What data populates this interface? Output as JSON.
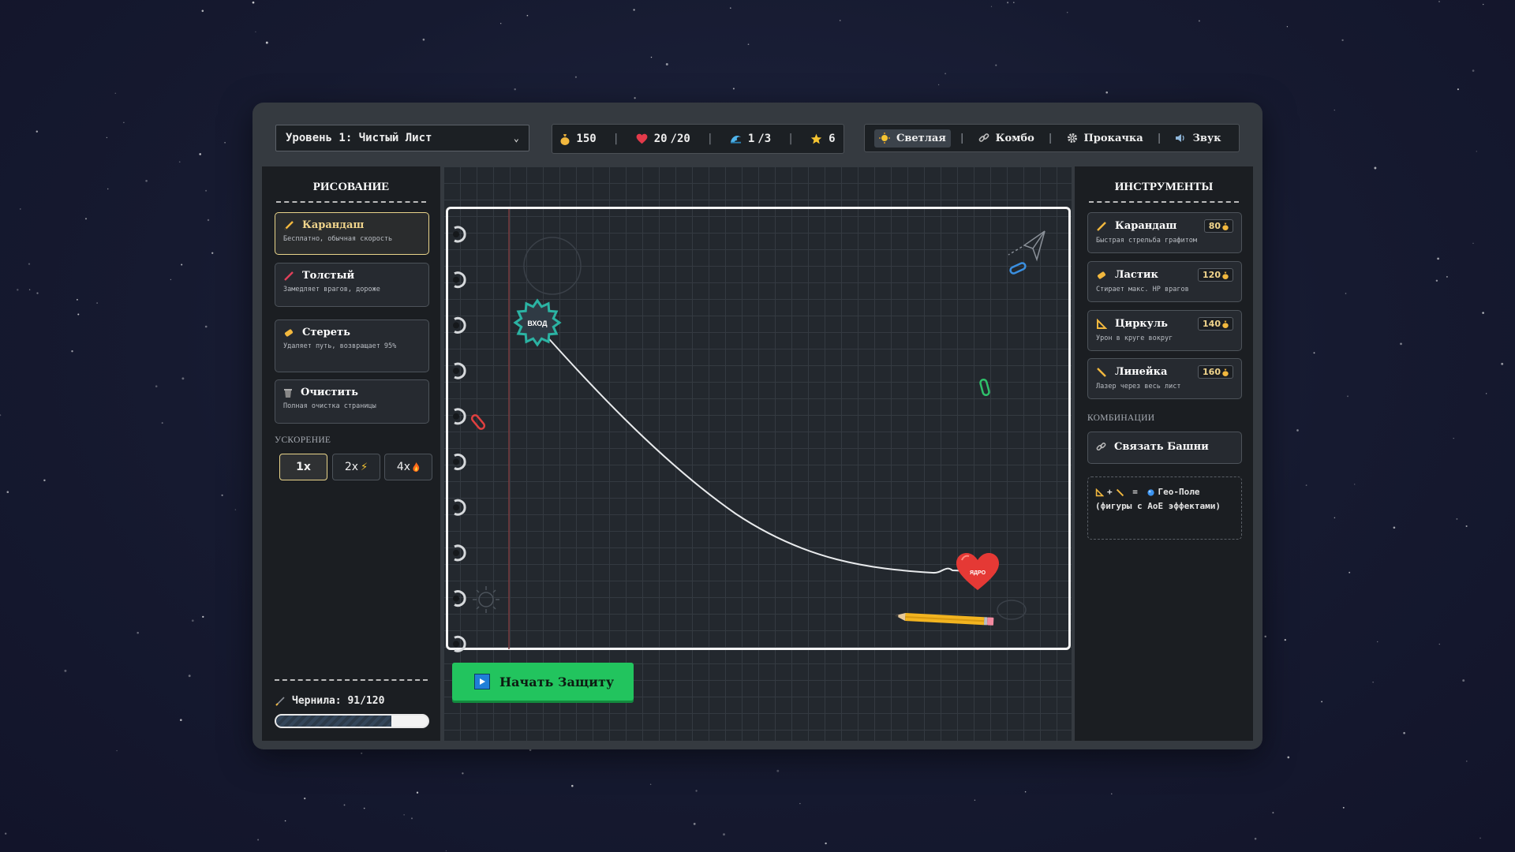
{
  "level": {
    "label": "Уровень 1: Чистый Лист"
  },
  "stats": {
    "gold": "150",
    "hp_current": "20",
    "hp_max": "/20",
    "wave_current": "1",
    "wave_total": "/3",
    "stars": "6"
  },
  "toolbar": {
    "theme": "Светлая",
    "combo": "Комбо",
    "upgrade": "Прокачка",
    "sound": "Звук"
  },
  "drawing": {
    "title": "РИСОВАНИЕ",
    "tools": [
      {
        "name": "Карандаш",
        "desc": "Бесплатно, обычная скорость"
      },
      {
        "name": "Толстый",
        "desc": "Замедляет врагов, дороже"
      },
      {
        "name": "Стереть",
        "desc": "Удаляет путь, возвращает 95%"
      },
      {
        "name": "Очистить",
        "desc": "Полная очистка страницы"
      }
    ],
    "speed_label": "УСКОРЕНИЕ",
    "speeds": [
      "1x",
      "2x",
      "4x"
    ],
    "ink_label": "Чернила: 91/120",
    "ink_fraction": 0.76
  },
  "board": {
    "start_label": "ВХОД",
    "end_label": "ЯДРО",
    "start_button": "Начать Защиту"
  },
  "tools": {
    "title": "ИНСТРУМЕНТЫ",
    "items": [
      {
        "name": "Карандаш",
        "desc": "Быстрая стрельба графитом",
        "price": "80"
      },
      {
        "name": "Ластик",
        "desc": "Стирает макс. HP врагов",
        "price": "120"
      },
      {
        "name": "Циркуль",
        "desc": "Урон в круге вокруг",
        "price": "140"
      },
      {
        "name": "Линейка",
        "desc": "Лазер через весь лист",
        "price": "160"
      }
    ],
    "combos_label": "КОМБИНАЦИИ",
    "link_button": "Связать Башни",
    "combo_result": "Гео-Поле",
    "combo_desc": "(фигуры с AoE эффектами)"
  },
  "colors": {
    "accent_gold": "#e9d48a",
    "start_green": "#22c45e",
    "path_teal": "#2bb3a3",
    "core_red": "#e53935"
  }
}
